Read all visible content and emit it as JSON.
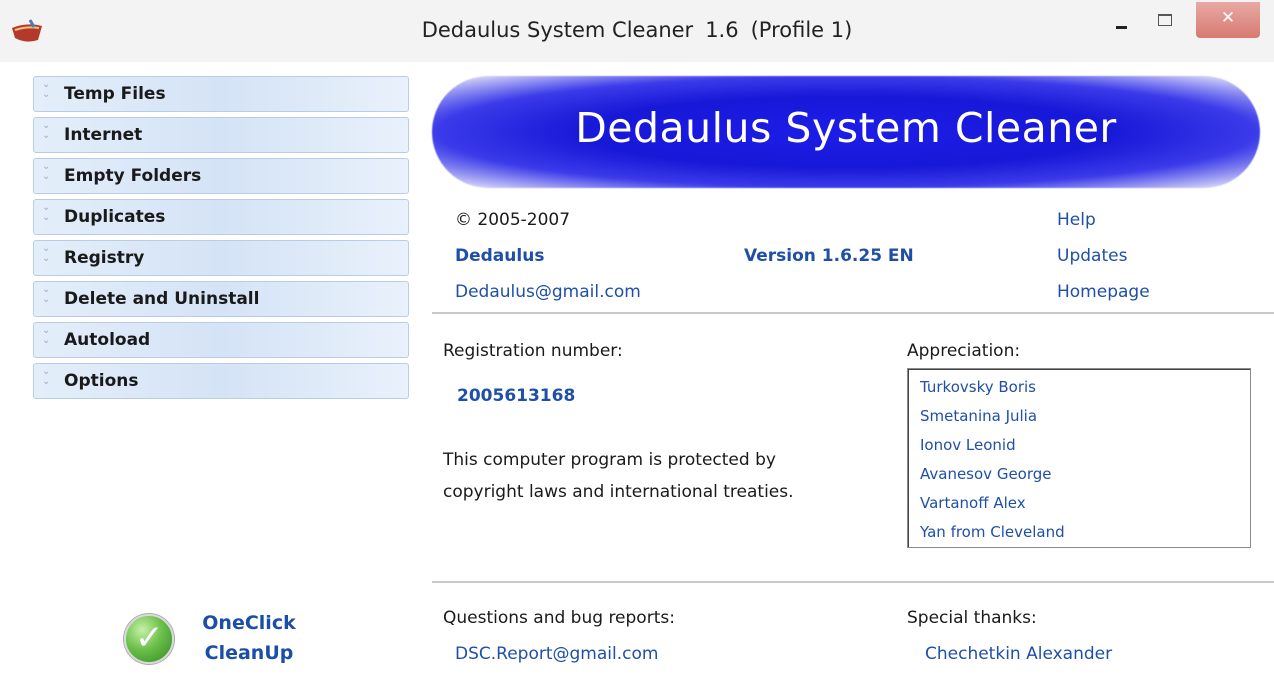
{
  "window": {
    "title_name": "Dedaulus System Cleaner",
    "title_version": "1.6",
    "title_profile": "(Profile 1)"
  },
  "sidebar": {
    "items": [
      {
        "label": "Temp Files"
      },
      {
        "label": "Internet"
      },
      {
        "label": "Empty Folders"
      },
      {
        "label": "Duplicates"
      },
      {
        "label": "Registry"
      },
      {
        "label": "Delete and Uninstall"
      },
      {
        "label": "Autoload"
      },
      {
        "label": "Options"
      }
    ],
    "oneclick_line1": "OneClick",
    "oneclick_line2": "CleanUp"
  },
  "about": {
    "banner": "Dedaulus System Cleaner",
    "copyright": "© 2005-2007",
    "author": "Dedaulus",
    "email": "Dedaulus@gmail.com",
    "version": "Version 1.6.25 EN",
    "links": {
      "help": "Help",
      "updates": "Updates",
      "homepage": "Homepage"
    },
    "registration_label": "Registration number:",
    "registration_number": "2005613168",
    "protection_text": "This computer program is protected by copyright laws and international treaties.",
    "appreciation_label": "Appreciation:",
    "appreciation": [
      "Turkovsky Boris",
      "Smetanina Julia",
      "Ionov Leonid",
      "Avanesov George",
      "Vartanoff Alex",
      "Yan from Cleveland"
    ],
    "bug_label": "Questions and bug reports:",
    "bug_email": "DSC.Report@gmail.com",
    "thanks_label": "Special thanks:",
    "thanks_name": "Chechetkin Alexander"
  },
  "colors": {
    "link": "#1f4fa8",
    "banner_blue": "#1818d8",
    "nav_bg": "#d4e3f6"
  }
}
